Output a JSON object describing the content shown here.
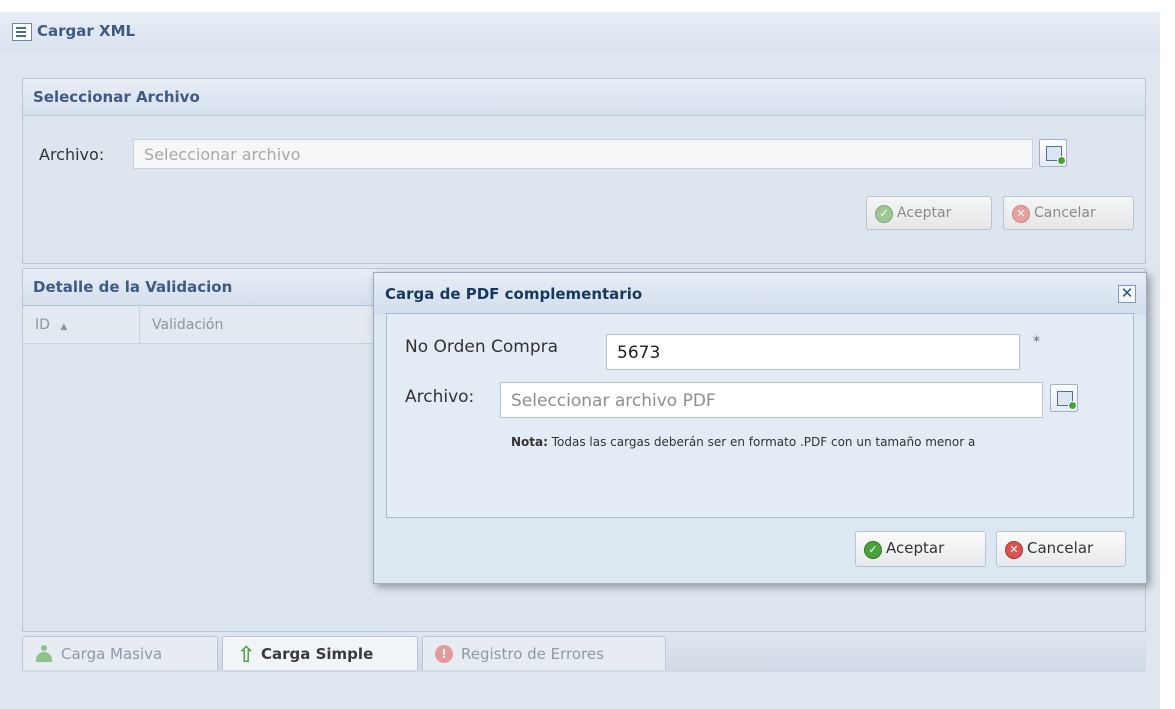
{
  "window": {
    "title": "Cargar XML"
  },
  "select_panel": {
    "title": "Seleccionar Archivo",
    "file_label": "Archivo:",
    "file_placeholder": "Seleccionar archivo",
    "accept_label": "Aceptar",
    "cancel_label": "Cancelar"
  },
  "detail_panel": {
    "title": "Detalle de la Validacion",
    "columns": [
      "ID",
      "Validación"
    ]
  },
  "tabs": [
    {
      "label": "Carga Masiva",
      "active": false,
      "icon": "users-icon"
    },
    {
      "label": "Carga Simple",
      "active": true,
      "icon": "upload-arrow-icon"
    },
    {
      "label": "Registro de Errores",
      "active": false,
      "icon": "error-icon"
    }
  ],
  "modal": {
    "title": "Carga de PDF complementario",
    "order_label": "No Orden Compra",
    "order_value": "5673",
    "required_mark": "*",
    "file_label": "Archivo:",
    "file_placeholder": "Seleccionar archivo PDF",
    "note_prefix": "Nota:",
    "note_text": "Todas las cargas deberán ser en formato .PDF con un tamaño menor a",
    "accept_label": "Aceptar",
    "cancel_label": "Cancelar"
  },
  "colors": {
    "accent": "#3e5a85",
    "ok": "#4aa33a",
    "cancel": "#d9534f"
  }
}
